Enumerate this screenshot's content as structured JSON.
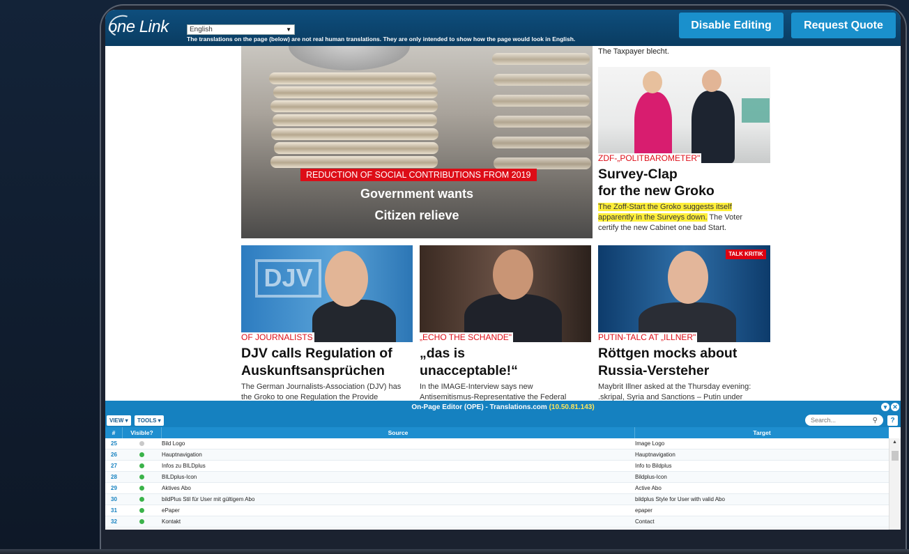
{
  "topbar": {
    "logo": "one Link",
    "language": "English",
    "disclaimer": "The translations on the page (below) are not real human translations. They are only intended to show how the page would look in English.",
    "disable_editing": "Disable Editing",
    "request_quote": "Request Quote"
  },
  "article": {
    "top_caption": "The Taxpayer blecht.",
    "hero": {
      "kicker": "REDUCTION OF SOCIAL CONTRIBUTIONS FROM 2019",
      "line1": "Government wants",
      "line2": "Citizen relieve"
    },
    "side": {
      "kicker": "ZDF-„POLITBAROMETER\"",
      "h1": "Survey-Clap",
      "h2": "for the new Groko",
      "hl1": "The Zoff-Start the Groko suggests itself",
      "hl2": "apparently in the Surveys down.",
      "rest": " The Voter",
      "line3": "certify the new Cabinet one bad Start."
    },
    "cards": [
      {
        "kicker": "OF JOURNALISTS",
        "title1": "DJV calls Regulation of",
        "title2": "Auskunftsansprüchen",
        "body1": "The German Journalists-Association (DJV) has",
        "body2": "the Groko to one Regulation the Provide"
      },
      {
        "kicker": "„ECHO THE SCHANDE\"",
        "title1": "„das is",
        "title2": "unacceptable!“",
        "body1": "In the IMAGE-Interview says new",
        "body2": "Antisemitismus-Representative the Federal"
      },
      {
        "kicker": "PUTIN-TALC AT „ILLNER\"",
        "title1": "Röttgen mocks about",
        "title2": "Russia-Versteher",
        "body1": "Maybrit Illner asked at the Thursday evening:",
        "body2": ".skripal, Syria and Sanctions – Putin under"
      }
    ],
    "talk_badge": "TALK KRITIK"
  },
  "ope": {
    "title": "On-Page Editor (OPE) - Translations.com ",
    "ip": "(10.50.81.143)",
    "view_btn": "VIEW ▾",
    "tools_btn": "TOOLS ▾",
    "search_placeholder": "Search...",
    "help": "?",
    "columns": {
      "num": "#",
      "visible": "Visible?",
      "source": "Source",
      "target": "Target"
    },
    "rows": [
      {
        "num": "25",
        "visible": false,
        "source": "Bild Logo",
        "target": "Image Logo"
      },
      {
        "num": "26",
        "visible": true,
        "source": "Hauptnavigation",
        "target": "Hauptnavigation"
      },
      {
        "num": "27",
        "visible": true,
        "source": "Infos zu BILDplus",
        "target": "Info to Bildplus"
      },
      {
        "num": "28",
        "visible": true,
        "source": "BILDplus-Icon",
        "target": "Bildplus-Icon"
      },
      {
        "num": "29",
        "visible": true,
        "source": "Aktives Abo",
        "target": "Active Abo"
      },
      {
        "num": "30",
        "visible": true,
        "source": "bildPlus Stil für User mit gültigem Abo",
        "target": "bildplus Style for User with valid Abo"
      },
      {
        "num": "31",
        "visible": true,
        "source": "ePaper",
        "target": "epaper"
      },
      {
        "num": "32",
        "visible": true,
        "source": "Kontakt",
        "target": "Contact"
      }
    ]
  }
}
